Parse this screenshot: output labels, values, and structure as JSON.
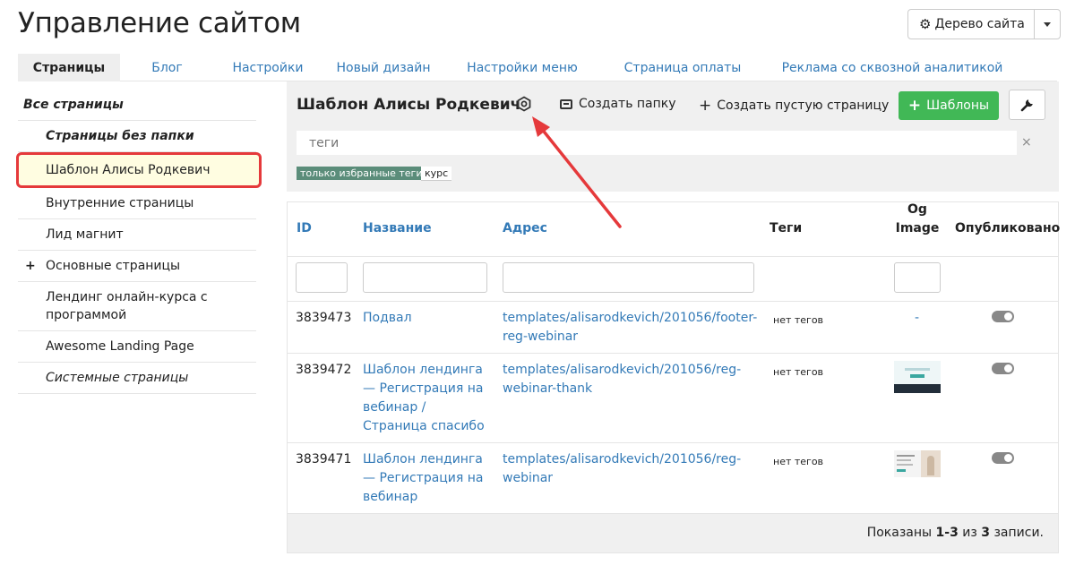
{
  "header": {
    "title": "Управление сайтом",
    "tree_button_label": "Дерево сайта"
  },
  "tabs": [
    {
      "label": "Страницы",
      "active": true
    },
    {
      "label": "Блог"
    },
    {
      "label": "Настройки"
    },
    {
      "label": "Новый дизайн"
    },
    {
      "label": "Настройки меню"
    },
    {
      "label": "Страница оплаты"
    },
    {
      "label": "Реклама со сквозной аналитикой"
    }
  ],
  "sidebar": {
    "items": [
      {
        "label": "Все страницы"
      },
      {
        "label": "Страницы без папки"
      },
      {
        "label": "Шаблон Алисы Родкевич",
        "selected": true
      },
      {
        "label": "Внутренние страницы"
      },
      {
        "label": "Лид магнит"
      },
      {
        "label": "Основные страницы",
        "prefix": "+"
      },
      {
        "label": "Лендинг онлайн-курса с программой"
      },
      {
        "label": "Awesome Landing Page"
      },
      {
        "label": "Системные страницы"
      }
    ]
  },
  "folder": {
    "title": "Шаблон Алисы Родкевич",
    "create_folder_label": "Создать папку",
    "create_page_label": "Создать пустую страницу",
    "templates_label": "Шаблоны",
    "tags_placeholder": "теги",
    "tags_clear": "×",
    "tag_favorites": "только избранные теги",
    "tag_kurs": "курс"
  },
  "table": {
    "columns": {
      "id": "ID",
      "name": "Название",
      "address": "Адрес",
      "tags": "Теги",
      "og_line1": "Og",
      "og_line2": "Image",
      "published": "Опубликовано"
    },
    "rows": [
      {
        "id": "3839473",
        "name": "Подвал",
        "address": "templates/alisarodkevich/201056/footer-reg-webinar",
        "tags": "нет тегов",
        "og": "-",
        "published": false
      },
      {
        "id": "3839472",
        "name": "Шаблон лендинга — Регистрация на вебинар / Страница спасибо",
        "address": "templates/alisarodkevich/201056/reg-webinar-thank",
        "tags": "нет тегов",
        "published": false
      },
      {
        "id": "3839471",
        "name": "Шаблон лендинга — Регистрация на вебинар",
        "address": "templates/alisarodkevich/201056/reg-webinar",
        "tags": "нет тегов",
        "published": false
      }
    ],
    "summary_prefix": "Показаны",
    "summary_range": "1-3",
    "summary_mid": "из",
    "summary_total": "3",
    "summary_suffix": "записи."
  },
  "colors": {
    "accent_link": "#337ab7",
    "templates_btn": "#41b856",
    "selected_border": "#e5393b",
    "arrow": "#e5393b"
  }
}
